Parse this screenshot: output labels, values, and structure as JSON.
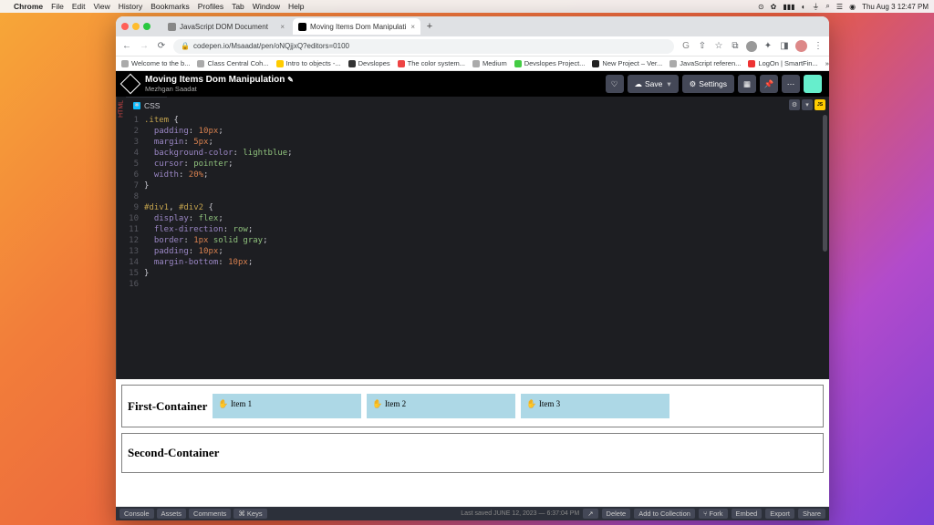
{
  "menubar": {
    "app": "Chrome",
    "items": [
      "File",
      "Edit",
      "View",
      "History",
      "Bookmarks",
      "Profiles",
      "Tab",
      "Window",
      "Help"
    ],
    "clock": "Thu Aug 3  12:47 PM"
  },
  "browser": {
    "tabs": [
      {
        "title": "JavaScript DOM Document",
        "active": false
      },
      {
        "title": "Moving Items Dom Manipulati",
        "active": true
      }
    ],
    "url": "codepen.io/Msaadat/pen/oNQjjxQ?editors=0100",
    "bookmarks": [
      "Welcome to the b...",
      "Class Central Coh...",
      "Intro to objects -...",
      "Devslopes",
      "The color system...",
      "Medium",
      "Devslopes Project...",
      "New Project – Ver...",
      "JavaScript referen...",
      "LogOn | SmartFin..."
    ]
  },
  "codepen": {
    "title": "Moving Items Dom Manipulation",
    "author": "Mezhgan Saadat",
    "save_label": "Save",
    "settings_label": "Settings",
    "panel_label": "CSS",
    "html_label": "HTML",
    "code_lines": [
      {
        "n": "1",
        "html": "<span class='tok-sel'>.item</span> <span class='tok-punc'>{</span>"
      },
      {
        "n": "2",
        "html": "  <span class='tok-prop'>padding</span><span class='tok-punc'>:</span> <span class='tok-num'>10px</span><span class='tok-punc'>;</span>"
      },
      {
        "n": "3",
        "html": "  <span class='tok-prop'>margin</span><span class='tok-punc'>:</span> <span class='tok-num'>5px</span><span class='tok-punc'>;</span>"
      },
      {
        "n": "4",
        "html": "  <span class='tok-prop'>background-color</span><span class='tok-punc'>:</span> <span class='tok-val'>lightblue</span><span class='tok-punc'>;</span>"
      },
      {
        "n": "5",
        "html": "  <span class='tok-prop'>cursor</span><span class='tok-punc'>:</span> <span class='tok-val'>pointer</span><span class='tok-punc'>;</span>"
      },
      {
        "n": "6",
        "html": "  <span class='tok-prop'>width</span><span class='tok-punc'>:</span> <span class='tok-num'>20%</span><span class='tok-punc'>;</span>"
      },
      {
        "n": "7",
        "html": "<span class='tok-punc'>}</span>"
      },
      {
        "n": "8",
        "html": ""
      },
      {
        "n": "9",
        "html": "<span class='tok-sel'>#div1</span><span class='tok-punc'>,</span> <span class='tok-sel'>#div2</span> <span class='tok-punc'>{</span>"
      },
      {
        "n": "10",
        "html": "  <span class='tok-prop'>display</span><span class='tok-punc'>:</span> <span class='tok-val'>flex</span><span class='tok-punc'>;</span>"
      },
      {
        "n": "11",
        "html": "  <span class='tok-prop'>flex-direction</span><span class='tok-punc'>:</span> <span class='tok-val'>row</span><span class='tok-punc'>;</span>"
      },
      {
        "n": "12",
        "html": "  <span class='tok-prop'>border</span><span class='tok-punc'>:</span> <span class='tok-num'>1px</span> <span class='tok-val'>solid</span> <span class='tok-val'>gray</span><span class='tok-punc'>;</span>"
      },
      {
        "n": "13",
        "html": "  <span class='tok-prop'>padding</span><span class='tok-punc'>:</span> <span class='tok-num'>10px</span><span class='tok-punc'>;</span>"
      },
      {
        "n": "14",
        "html": "  <span class='tok-prop'>margin-bottom</span><span class='tok-punc'>:</span> <span class='tok-num'>10px</span><span class='tok-punc'>;</span>"
      },
      {
        "n": "15",
        "html": "<span class='tok-punc'>}</span>"
      },
      {
        "n": "16",
        "html": ""
      }
    ],
    "footer": {
      "left": [
        "Console",
        "Assets",
        "Comments",
        "Keys"
      ],
      "saved": "Last saved JUNE 12, 2023 — 6:37:04 PM",
      "right": [
        "Delete",
        "Add to Collection",
        "Fork",
        "Embed",
        "Export",
        "Share"
      ]
    }
  },
  "preview": {
    "c1_heading": "First-Container",
    "c2_heading": "Second-Container",
    "items": [
      "Item 1",
      "Item 2",
      "Item 3"
    ]
  }
}
